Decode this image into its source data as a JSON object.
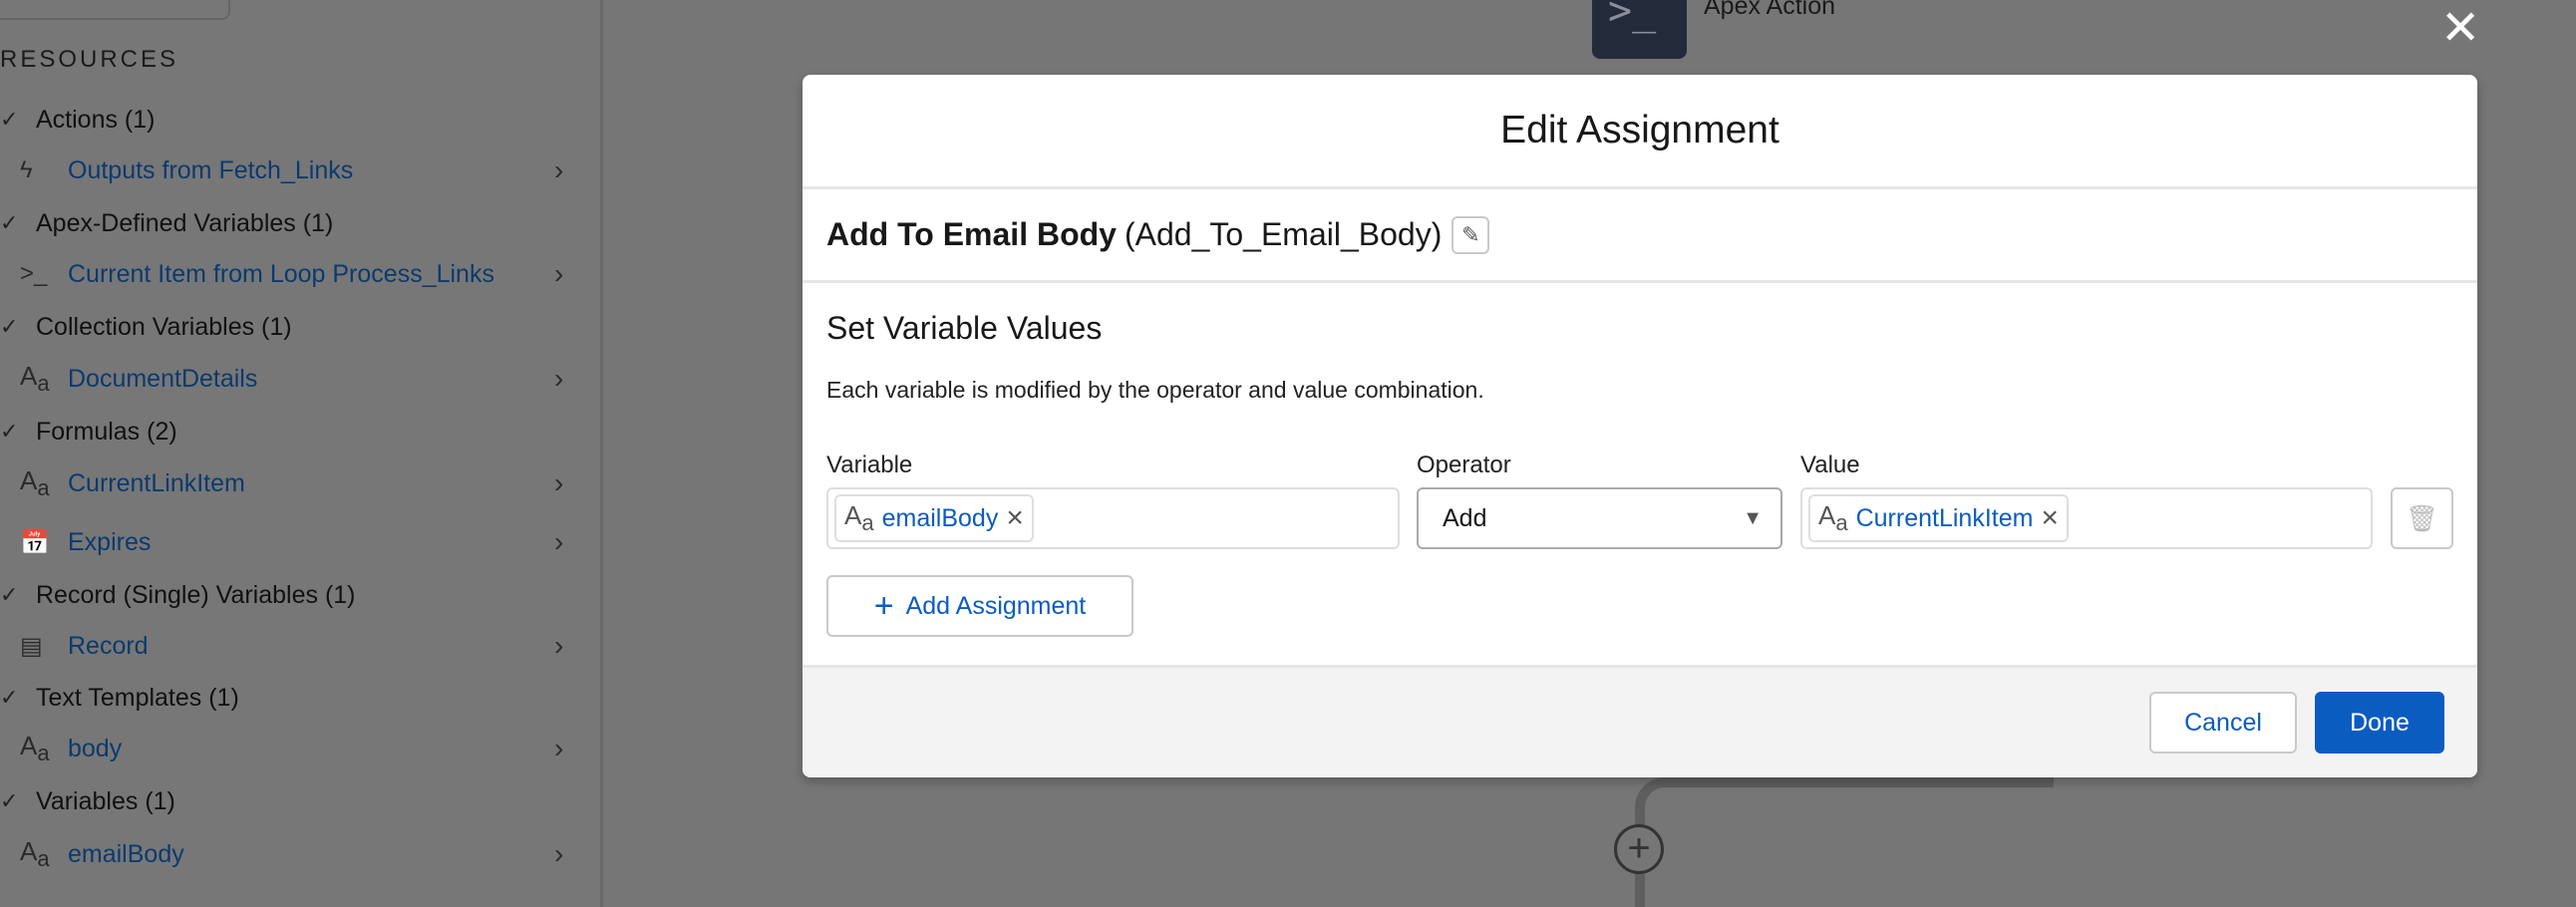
{
  "sidebar": {
    "heading": "RESOURCES",
    "rows": [
      {
        "type": "category",
        "label": "Actions (1)"
      },
      {
        "type": "item",
        "icon": "lightning-icon",
        "label": "Outputs from Fetch_Links"
      },
      {
        "type": "category",
        "label": "Apex-Defined Variables (1)"
      },
      {
        "type": "item",
        "icon": "apex-icon",
        "label": "Current Item from Loop Process_Links"
      },
      {
        "type": "category",
        "label": "Collection Variables (1)"
      },
      {
        "type": "item",
        "icon": "text-type-icon",
        "label": "DocumentDetails"
      },
      {
        "type": "category",
        "label": "Formulas (2)"
      },
      {
        "type": "item",
        "icon": "text-type-icon",
        "label": "CurrentLinkItem"
      },
      {
        "type": "item",
        "icon": "calendar-time-icon",
        "label": "Expires"
      },
      {
        "type": "category",
        "label": "Record (Single) Variables (1)"
      },
      {
        "type": "item",
        "icon": "record-icon",
        "label": "Record"
      },
      {
        "type": "category",
        "label": "Text Templates (1)"
      },
      {
        "type": "item",
        "icon": "text-type-icon",
        "label": "body"
      },
      {
        "type": "category",
        "label": "Variables (1)"
      },
      {
        "type": "item",
        "icon": "text-type-icon",
        "label": "emailBody"
      }
    ]
  },
  "canvas": {
    "node_label": "Apex Action"
  },
  "modal": {
    "title": "Edit Assignment",
    "element_label": "Add To Email Body",
    "element_api_name": "(Add_To_Email_Body)",
    "section_title": "Set Variable Values",
    "description": "Each variable is modified by the operator and value combination.",
    "columns": {
      "variable": "Variable",
      "operator": "Operator",
      "value": "Value"
    },
    "row": {
      "variable": "emailBody",
      "operator": "Add",
      "value": "CurrentLinkItem"
    },
    "add_assignment": "Add Assignment",
    "cancel": "Cancel",
    "done": "Done"
  },
  "colors": {
    "brand": "#0b5cc1",
    "overlay": "#767676"
  }
}
